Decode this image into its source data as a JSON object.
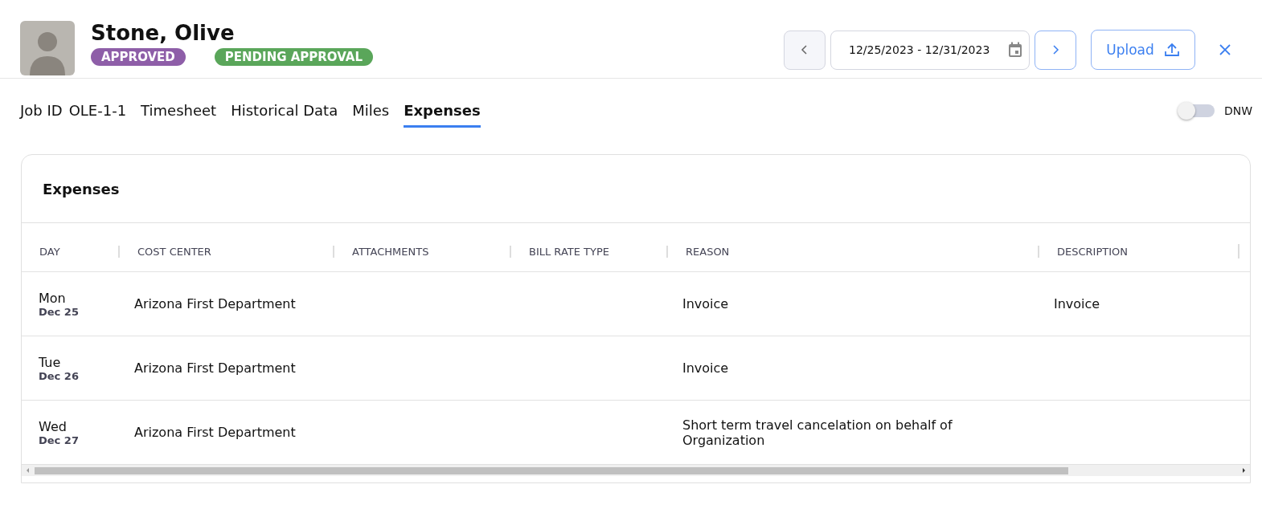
{
  "header": {
    "name": "Stone, Olive",
    "badges": [
      {
        "label": "APPROVED",
        "color": "#8e5ea8"
      },
      {
        "label": "PENDING APPROVAL",
        "color": "#5aa65a"
      }
    ],
    "date_range": "12/25/2023 - 12/31/2023",
    "upload_label": "Upload"
  },
  "job": {
    "label": "Job ID",
    "value": "OLE-1-1"
  },
  "tabs": [
    {
      "label": "Timesheet",
      "selected": false
    },
    {
      "label": "Historical Data",
      "selected": false
    },
    {
      "label": "Miles",
      "selected": false
    },
    {
      "label": "Expenses",
      "selected": true
    }
  ],
  "dnw_toggle": {
    "label": "DNW",
    "on": false
  },
  "panel": {
    "title": "Expenses"
  },
  "table": {
    "columns": [
      "DAY",
      "COST CENTER",
      "ATTACHMENTS",
      "BILL RATE TYPE",
      "REASON",
      "DESCRIPTION"
    ],
    "rows": [
      {
        "weekday": "Mon",
        "date": "Dec 25",
        "cost_center": "Arizona First Department",
        "attachments": "",
        "bill_rate_type": "",
        "reason": "Invoice",
        "description": "Invoice"
      },
      {
        "weekday": "Tue",
        "date": "Dec 26",
        "cost_center": "Arizona First Department",
        "attachments": "",
        "bill_rate_type": "",
        "reason": "Invoice",
        "description": ""
      },
      {
        "weekday": "Wed",
        "date": "Dec 27",
        "cost_center": "Arizona First Department",
        "attachments": "",
        "bill_rate_type": "",
        "reason": "Short term travel cancelation on behalf of Organization",
        "description": ""
      }
    ]
  }
}
